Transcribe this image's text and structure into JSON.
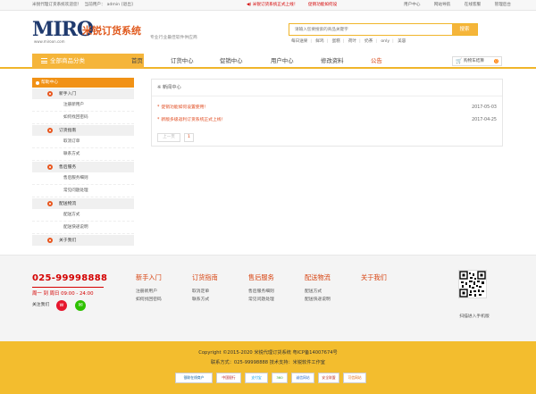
{
  "topbar": {
    "welcome": "米锐代理订货系统欢迎您！",
    "current_user_label": "当前用户：",
    "user": "admin",
    "logout": "[退出]",
    "notice1": "米锐订货系统正式上线！",
    "notice2": "促销功能如何设",
    "links": [
      "用户中心",
      "网站导航",
      "在线客服",
      "管理后台"
    ]
  },
  "header": {
    "logo_text": "MIRO",
    "logo_url": "www.miroon.com",
    "logo_cn": "米锐订货系统",
    "slogan": "专业行业最佳软件供应商",
    "search_placeholder": "请输入您要搜索的商品关键字",
    "search_button": "搜索",
    "hotwords": [
      "每日送果",
      "鲜鸡",
      "蛋糕",
      "荷叶",
      "奶茶",
      "only",
      "美容"
    ]
  },
  "nav": {
    "all_categories": "全部商品分类",
    "items": [
      {
        "label": "首页",
        "active": false
      },
      {
        "label": "订货中心",
        "active": false
      },
      {
        "label": "促销中心",
        "active": false
      },
      {
        "label": "用户中心",
        "active": false
      },
      {
        "label": "修改资料",
        "active": false
      },
      {
        "label": "公告",
        "active": true
      }
    ],
    "cart_label": "购物车结算",
    "cart_count": "0"
  },
  "sidebar": {
    "title": "帮助中心",
    "groups": [
      {
        "title": "新手入门",
        "items": [
          "注册新用户",
          "如何找回密码"
        ]
      },
      {
        "title": "订货指南",
        "items": [
          "取消订单",
          "联系方式"
        ]
      },
      {
        "title": "售后服务",
        "items": [
          "售后服务细则",
          "常见问题处理"
        ]
      },
      {
        "title": "配送物流",
        "items": [
          "配送方式",
          "配送快递说明"
        ]
      },
      {
        "title": "关于我们",
        "items": []
      }
    ]
  },
  "news": {
    "title": "※ 新闻中心",
    "items": [
      {
        "title": "促销功能如何设置使用！",
        "date": "2017-05-03"
      },
      {
        "title": "新版多级返利订货系统正式上线！",
        "date": "2017-04-25"
      }
    ],
    "pager_prev": "上一页",
    "pager_current": "1"
  },
  "footer": {
    "phone": "025-99998888",
    "hours": "周一 到 周日  09:00 - 24:00",
    "follow": "关注我们",
    "columns": [
      {
        "title": "新手入门",
        "items": [
          "注册新用户",
          "如何找回密码"
        ]
      },
      {
        "title": "订货指南",
        "items": [
          "取消定单",
          "联系方式"
        ]
      },
      {
        "title": "售后服务",
        "items": [
          "售后服务细则",
          "常见问题处理"
        ]
      },
      {
        "title": "配送物流",
        "items": [
          "配送方式",
          "配送快递说明"
        ]
      },
      {
        "title": "关于我们",
        "items": []
      }
    ],
    "qr_caption": "扫描进入手机版",
    "copyright": "Copyright ©2015-2020 米锐代理订货系统 粤ICP备14007674号",
    "contact": "联系方式：025-99998888 技术支持：米锐软件工作室",
    "badges": [
      "银联在线商户",
      "中国银行",
      "支付宝",
      "360",
      "诚信网站",
      "安全联盟",
      "可信网站"
    ]
  },
  "colors": {
    "accent": "#f5b53a",
    "red": "#d40000",
    "orange": "#e8571f",
    "sidebar_head": "#f19216"
  }
}
